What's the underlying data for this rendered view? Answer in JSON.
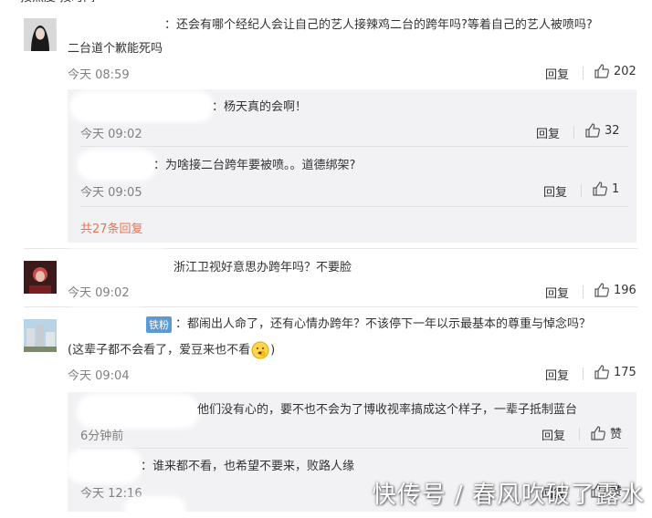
{
  "header": {
    "text": "按热度   按时间"
  },
  "c1": {
    "text_line1": "：还会有哪个经纪人会让自己的艺人接辣鸡二台的跨年吗?等着自己的艺人被喷吗?",
    "text_line2": "二台道个歉能死吗",
    "time": "今天 08:59",
    "reply": "回复",
    "likes": "202",
    "replies": [
      {
        "text": "：杨天真的会啊！",
        "time": "今天 09:02",
        "reply": "回复",
        "likes": "32"
      },
      {
        "text": "：为啥接二台跨年要被喷。。道德绑架?",
        "time": "今天 09:05",
        "reply": "回复",
        "likes": "1"
      }
    ],
    "more": "共27条回复"
  },
  "c2": {
    "text": "浙江卫视好意思办跨年吗？不要脸",
    "time": "今天 09:02",
    "reply": "回复",
    "likes": "196"
  },
  "c3": {
    "badge": "铁粉",
    "text_line1": "：都闹出人命了，还有心情办跨年？不该停下一年以示最基本的尊重与悼念吗？",
    "text_line2": "(这辈子都不会看了，爱豆来也不看",
    "text_line2_end": ")",
    "time": "今天 09:04",
    "reply": "回复",
    "likes": "175",
    "replies": [
      {
        "text": "他们没有心的，要不也不会为了博收视率搞成这个样子，一辈子抵制蓝台",
        "time": "6分钟前",
        "reply": "回复",
        "likes": "赞"
      },
      {
        "text": "：谁来都不看，也希望不要来，败路人缘",
        "time": "今天 12:16",
        "reply": "回复",
        "likes": "赞"
      }
    ]
  },
  "watermark": "快传号 / 春风吹破了露水"
}
